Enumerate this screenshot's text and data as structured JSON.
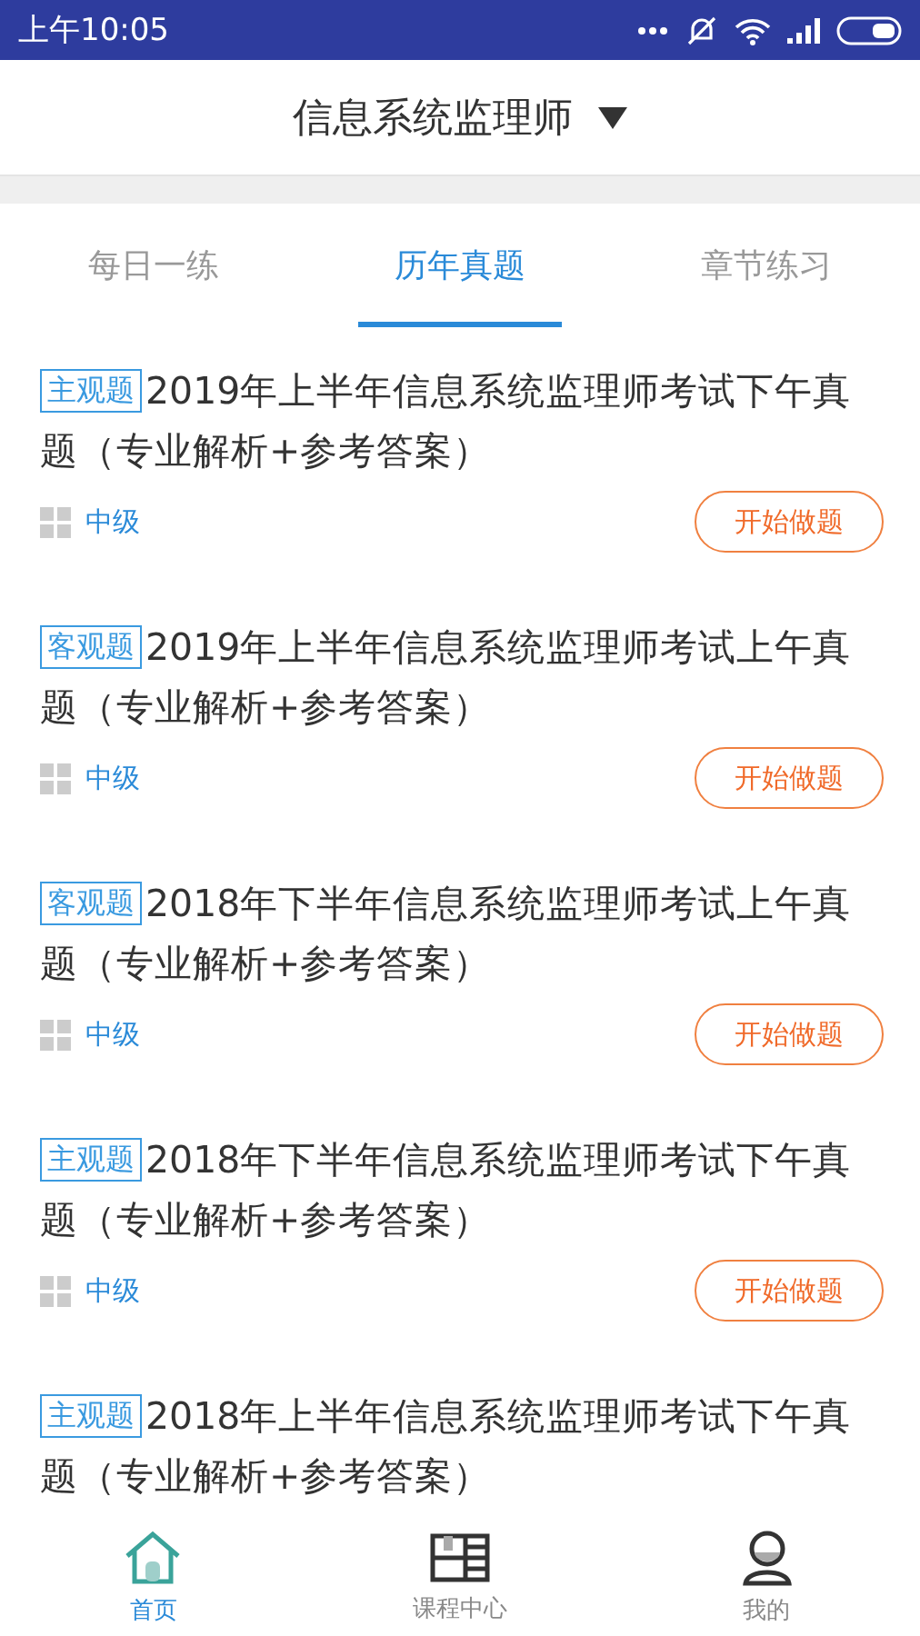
{
  "status_bar": {
    "time": "上午10:05"
  },
  "header": {
    "title": "信息系统监理师"
  },
  "tabs": [
    {
      "label": "每日一练",
      "selected": false
    },
    {
      "label": "历年真题",
      "selected": true
    },
    {
      "label": "章节练习",
      "selected": false
    }
  ],
  "papers": [
    {
      "tag": "主观题",
      "title": "2019年上半年信息系统监理师考试下午真题（专业解析+参考答案）",
      "level": "中级",
      "action": "开始做题"
    },
    {
      "tag": "客观题",
      "title": "2019年上半年信息系统监理师考试上午真题（专业解析+参考答案）",
      "level": "中级",
      "action": "开始做题"
    },
    {
      "tag": "客观题",
      "title": "2018年下半年信息系统监理师考试上午真题（专业解析+参考答案）",
      "level": "中级",
      "action": "开始做题"
    },
    {
      "tag": "主观题",
      "title": "2018年下半年信息系统监理师考试下午真题（专业解析+参考答案）",
      "level": "中级",
      "action": "开始做题"
    },
    {
      "tag": "主观题",
      "title": "2018年上半年信息系统监理师考试下午真题（专业解析+参考答案）"
    }
  ],
  "bottom_nav": [
    {
      "label": "首页",
      "kind": "home",
      "selected": true
    },
    {
      "label": "课程中心",
      "kind": "book",
      "selected": false
    },
    {
      "label": "我的",
      "kind": "user",
      "selected": false
    }
  ]
}
